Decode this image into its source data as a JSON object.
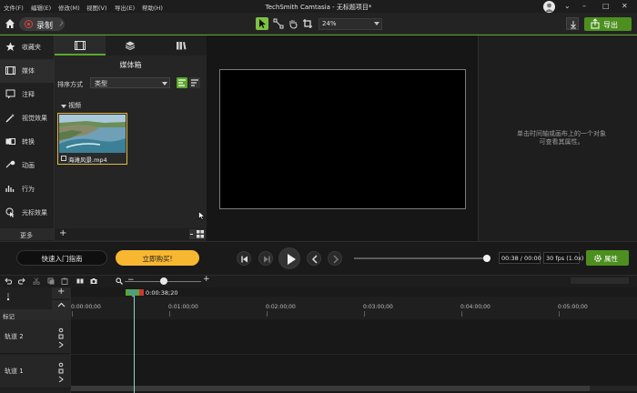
{
  "menu": [
    "文件(F)",
    "编辑(E)",
    "修改(M)",
    "视图(V)",
    "导出(E)",
    "帮助(H)"
  ],
  "title": "TechSmith Camtasia - 无标题项目*",
  "toolbar": {
    "record_label": "录制",
    "zoom": "24%",
    "export_label": "导出"
  },
  "sidebar": {
    "items": [
      {
        "label": "收藏夹",
        "icon": "star-icon"
      },
      {
        "label": "媒体",
        "icon": "film-icon"
      },
      {
        "label": "注释",
        "icon": "annotation-icon"
      },
      {
        "label": "视觉效果",
        "icon": "wand-icon"
      },
      {
        "label": "转换",
        "icon": "transition-icon"
      },
      {
        "label": "动画",
        "icon": "animation-icon"
      },
      {
        "label": "行为",
        "icon": "behavior-icon"
      },
      {
        "label": "光标效果",
        "icon": "cursor-effect-icon"
      }
    ],
    "more_label": "更多"
  },
  "media": {
    "title": "媒体箱",
    "sort_label": "排序方式",
    "sort_value": "类型",
    "group_label": "视频",
    "clip_name": "海滩风景.mp4"
  },
  "properties": {
    "hint_line1": "单击时间轴或画布上的一个对象",
    "hint_line2": "可查看其属性。"
  },
  "controls": {
    "quickstart_label": "快速入门指南",
    "buy_label": "立即购买!",
    "progress": 1.0,
    "time": "00:38 / 00:00",
    "fps": "30 fps (1.0x)",
    "props_label": "属性"
  },
  "timeline": {
    "playhead_time": "0:00:38;20",
    "marker_label": "标记",
    "ticks": [
      "0:00:00;00",
      "0:01:00;00",
      "0:02:00;00",
      "0:03:00;00",
      "0:04:00;00",
      "0:05:00;00"
    ],
    "tracks": [
      "轨道 2",
      "轨道 1"
    ]
  },
  "colors": {
    "accent": "#5aa72a",
    "buy": "#f7b730",
    "record": "#e34141"
  }
}
